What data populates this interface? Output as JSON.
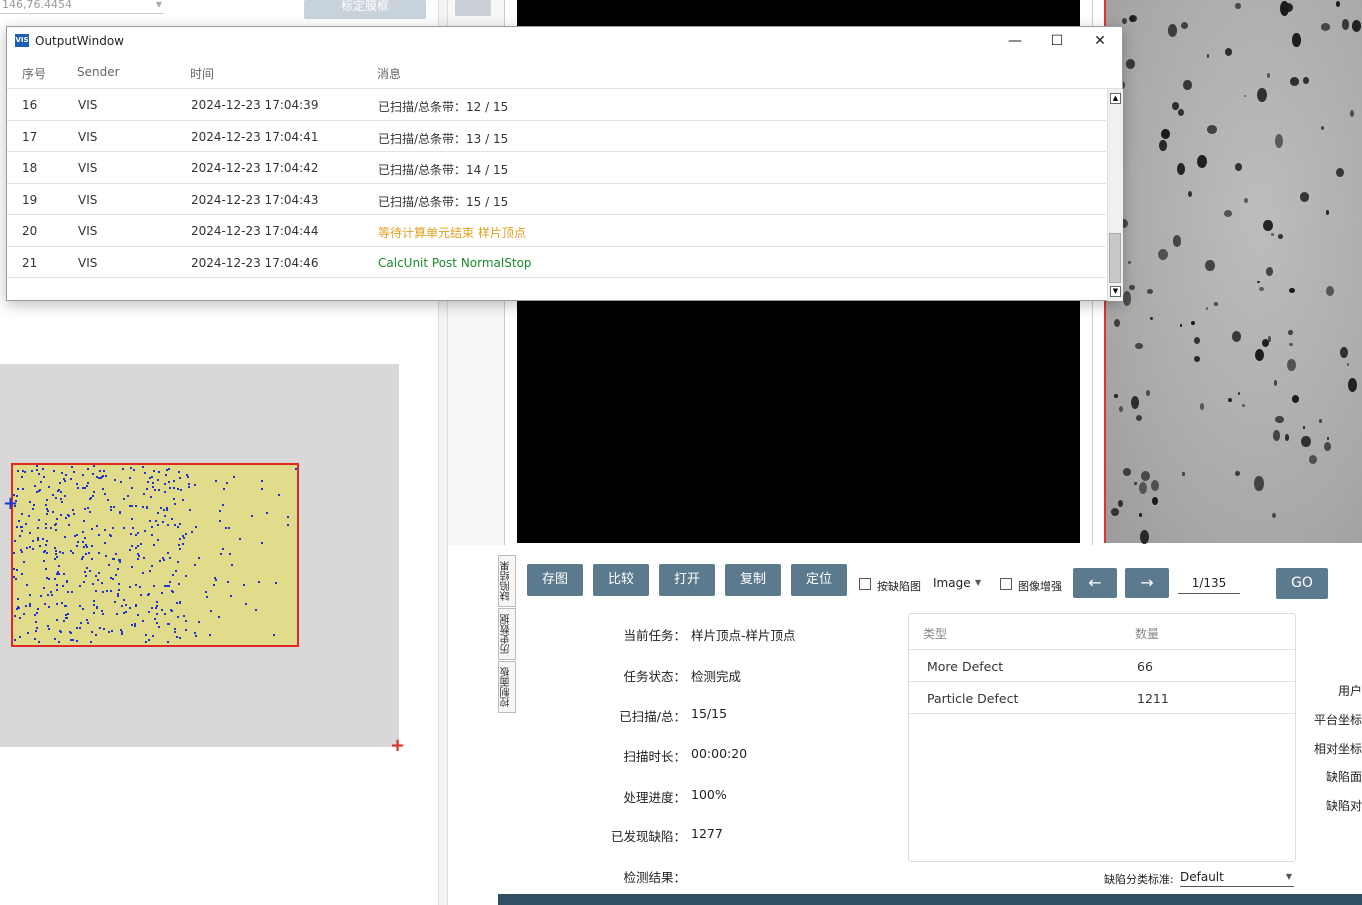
{
  "left_panel": {
    "coord_value": "146,76.4454",
    "calib_button": "标定膜框"
  },
  "output_window": {
    "title": "OutputWindow",
    "logo_text": "VIS",
    "controls": {
      "minimize": "—",
      "maximize": "☐",
      "close": "✕"
    },
    "columns": {
      "index": "序号",
      "sender": "Sender",
      "time": "时间",
      "message": "消息"
    },
    "rows": [
      {
        "index": "16",
        "sender": "VIS",
        "time": "2024-12-23 17:04:39",
        "message": "已扫描/总条带：12 / 15"
      },
      {
        "index": "17",
        "sender": "VIS",
        "time": "2024-12-23 17:04:41",
        "message": "已扫描/总条带：13 / 15"
      },
      {
        "index": "18",
        "sender": "VIS",
        "time": "2024-12-23 17:04:42",
        "message": "已扫描/总条带：14 / 15"
      },
      {
        "index": "19",
        "sender": "VIS",
        "time": "2024-12-23 17:04:43",
        "message": "已扫描/总条带：15 / 15"
      },
      {
        "index": "20",
        "sender": "VIS",
        "time": "2024-12-23 17:04:44",
        "message": "等待计算单元结束 样片顶点"
      },
      {
        "index": "21",
        "sender": "VIS",
        "time": "2024-12-23 17:04:46",
        "message": "CalcUnit Post NormalStop"
      }
    ],
    "message_colors": {
      "warning": "#e0a020",
      "success": "#1a8a2a"
    }
  },
  "side_tabs": [
    "缺陷结果",
    "历史数据",
    "控制面板"
  ],
  "toolbar": {
    "save_image": "存图",
    "compare": "比较",
    "open": "打开",
    "copy": "复制",
    "locate": "定位",
    "by_defect_map": "按缺陷图",
    "image_mode": "Image",
    "image_enhance": "图像增强",
    "prev": "←",
    "next": "→",
    "page": "1/135",
    "go": "GO"
  },
  "task_info": [
    {
      "label": "当前任务：",
      "value": "样片顶点-样片顶点"
    },
    {
      "label": "任务状态：",
      "value": "检测完成"
    },
    {
      "label": "已扫描/总：",
      "value": "15/15"
    },
    {
      "label": "扫描时长：",
      "value": "00:00:20"
    },
    {
      "label": "处理进度：",
      "value": "100%"
    },
    {
      "label": "已发现缺陷：",
      "value": "1277"
    },
    {
      "label": "检测结果：",
      "value": ""
    }
  ],
  "defect_table": {
    "columns": {
      "type": "类型",
      "count": "数量"
    },
    "rows": [
      {
        "type": "More Defect",
        "count": "66"
      },
      {
        "type": "Particle Defect",
        "count": "1211"
      }
    ]
  },
  "classification": {
    "label": "缺陷分类标准:",
    "value": "Default"
  },
  "right_labels": [
    "用户",
    "平台坐标",
    "相对坐标",
    "缺陷面",
    "缺陷对"
  ],
  "colors": {
    "accent_button": "#5b7a8e",
    "wafer_border": "#e0291f",
    "wafer_fill": "#e0dc8c",
    "defect_dot": "#2233cc"
  }
}
